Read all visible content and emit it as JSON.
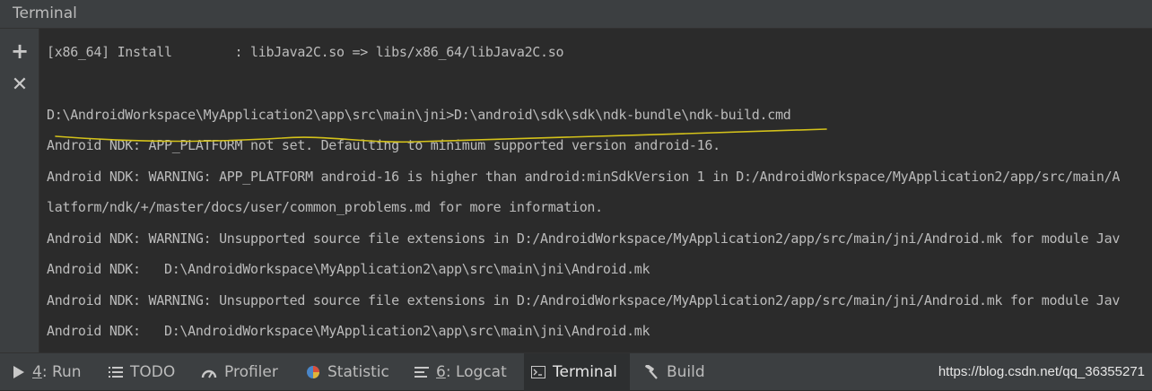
{
  "window": {
    "title": "Terminal"
  },
  "toolbar": {
    "add_icon": "+",
    "close_icon": "✕"
  },
  "console": {
    "lines": [
      "[x86_64] Install        : libJava2C.so => libs/x86_64/libJava2C.so",
      "D:\\AndroidWorkspace\\MyApplication2\\app\\src\\main\\jni>D:\\android\\sdk\\sdk\\ndk-bundle\\ndk-build.cmd",
      "Android NDK: APP_PLATFORM not set. Defaulting to minimum supported version android-16.",
      "Android NDK: WARNING: APP_PLATFORM android-16 is higher than android:minSdkVersion 1 in D:/AndroidWorkspace/MyApplication2/app/src/main/A",
      "latform/ndk/+/master/docs/user/common_problems.md for more information.",
      "Android NDK: WARNING: Unsupported source file extensions in D:/AndroidWorkspace/MyApplication2/app/src/main/jni/Android.mk for module Jav",
      "Android NDK:   D:\\AndroidWorkspace\\MyApplication2\\app\\src\\main\\jni\\Android.mk",
      "Android NDK: WARNING: Unsupported source file extensions in D:/AndroidWorkspace/MyApplication2/app/src/main/jni/Android.mk for module Jav",
      "Android NDK:   D:\\AndroidWorkspace\\MyApplication2\\app\\src\\main\\jni\\Android.mk"
    ]
  },
  "annotation": {
    "color": "#d4c21a"
  },
  "bottom_tabs": {
    "run": {
      "num": "4",
      "label": ": Run",
      "icon": "run-icon"
    },
    "todo": {
      "label": "TODO",
      "icon": "list-icon"
    },
    "profiler": {
      "label": "Profiler",
      "icon": "gauge-icon"
    },
    "statistic": {
      "label": "Statistic",
      "icon": "pie-icon"
    },
    "logcat": {
      "num": "6",
      "label": ": Logcat",
      "icon": "logcat-icon"
    },
    "terminal": {
      "label": "Terminal",
      "icon": "terminal-icon"
    },
    "build": {
      "label": "Build",
      "icon": "hammer-icon"
    }
  },
  "watermark": "https://blog.csdn.net/qq_36355271"
}
